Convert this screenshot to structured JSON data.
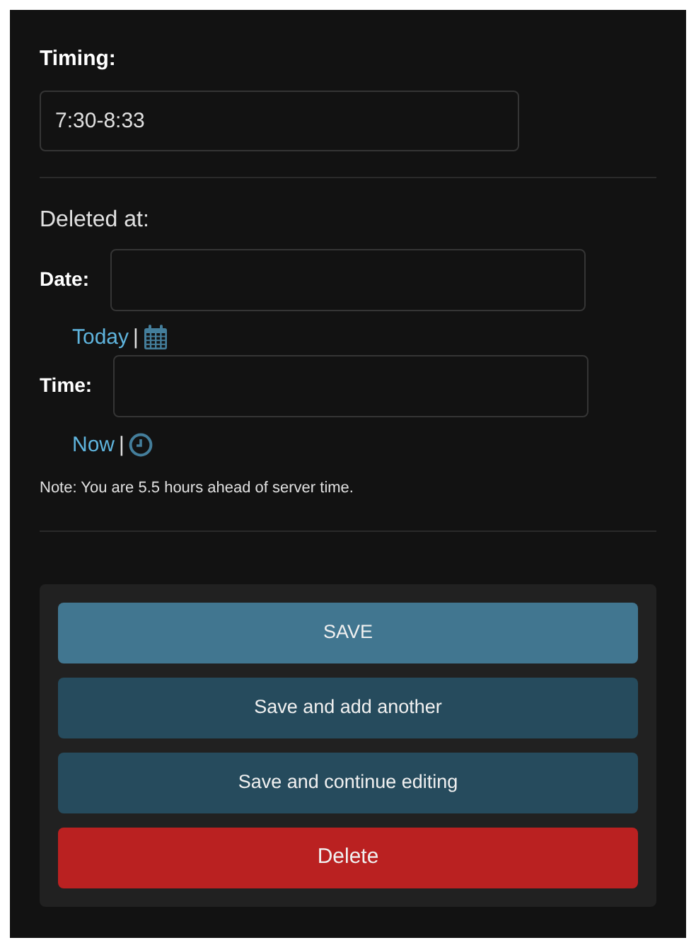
{
  "timing": {
    "label": "Timing:",
    "value": "7:30-8:33"
  },
  "deleted_at": {
    "heading": "Deleted at:",
    "date": {
      "label": "Date:",
      "shortcut": "Today",
      "separator": "|"
    },
    "time": {
      "label": "Time:",
      "shortcut": "Now",
      "separator": "|"
    },
    "note": "Note: You are 5.5 hours ahead of server time."
  },
  "buttons": [
    {
      "label": "SAVE",
      "kind": "primary"
    },
    {
      "label": "Save and add another",
      "kind": "secondary"
    },
    {
      "label": "Save and continue editing",
      "kind": "secondary"
    },
    {
      "label": "Delete",
      "kind": "danger"
    }
  ]
}
